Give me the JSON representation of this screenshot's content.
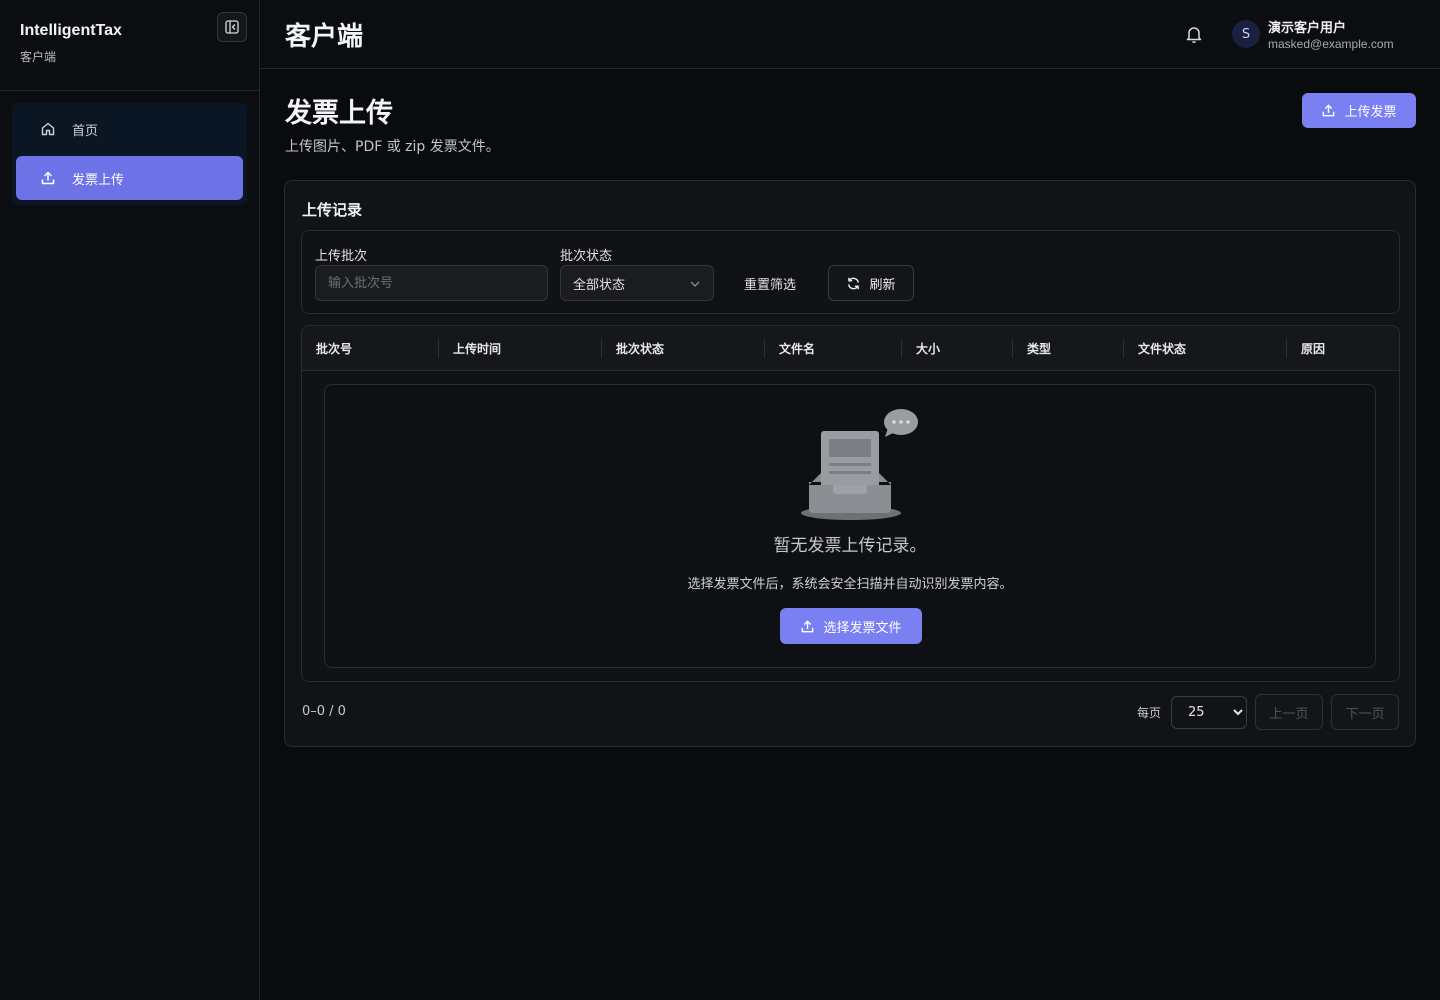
{
  "sidebar": {
    "brand_title": "IntelligentTax",
    "brand_sub": "客户端",
    "items": [
      {
        "label": "首页",
        "icon": "home-icon"
      },
      {
        "label": "发票上传",
        "icon": "upload-icon",
        "active": true
      }
    ]
  },
  "header": {
    "title": "客户端",
    "user_initial": "S",
    "user_name": "演示客户用户",
    "user_email": "masked@example.com"
  },
  "main": {
    "page_title": "发票上传",
    "page_sub": "上传图片、PDF 或 zip 发票文件。",
    "upload_button": "上传发票"
  },
  "records": {
    "title": "上传记录",
    "filters": {
      "batch_label": "上传批次",
      "batch_placeholder": "输入批次号",
      "status_label": "批次状态",
      "status_value": "全部状态",
      "reset_label": "重置筛选",
      "refresh_label": "刷新"
    },
    "columns": [
      "批次号",
      "上传时间",
      "批次状态",
      "文件名",
      "大小",
      "类型",
      "文件状态",
      "原因"
    ],
    "empty": {
      "title": "暂无发票上传记录。",
      "desc": "选择发票文件后，系统会安全扫描并自动识别发票内容。",
      "button": "选择发票文件"
    },
    "pagination": {
      "range": "0–0 / 0",
      "per_page_label": "每页",
      "per_page_value": "25",
      "prev": "上一页",
      "next": "下一页"
    }
  },
  "colors": {
    "accent": "#7a7ff2",
    "active_nav": "#6d72e6",
    "background": "#0a0b0d"
  }
}
